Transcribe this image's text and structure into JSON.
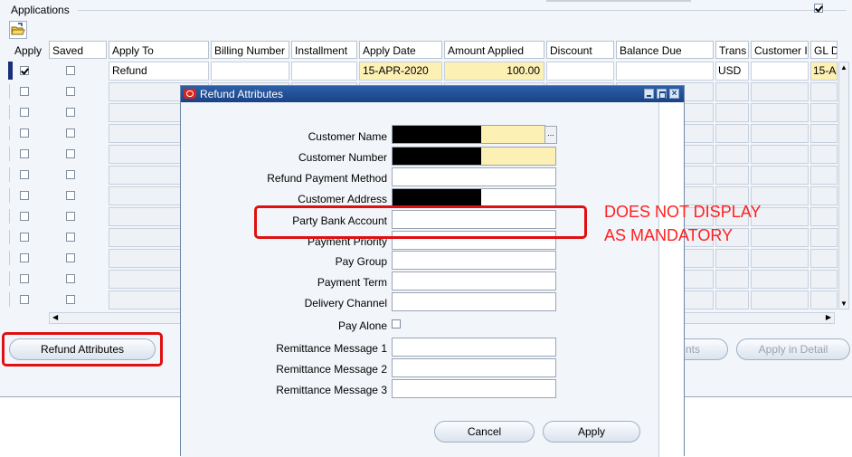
{
  "section": {
    "title": "Applications"
  },
  "columns": [
    "Apply",
    "Saved",
    "Apply To",
    "Billing Number",
    "Installment",
    "Apply Date",
    "Amount Applied",
    "Discount",
    "Balance Due",
    "Trans",
    "Customer I",
    "GL D"
  ],
  "row1": {
    "apply_to": "Refund",
    "apply_date": "15-APR-2020",
    "amount_applied": "100.00",
    "trans": "USD",
    "gl_date": "15-A"
  },
  "buttons": {
    "refund_attributes": "Refund Attributes",
    "adjustments_partial": "nts",
    "apply_in_detail": "Apply in Detail"
  },
  "dialog": {
    "title": "Refund Attributes",
    "labels": {
      "customer_name": "Customer Name",
      "customer_number": "Customer Number",
      "refund_payment_method": "Refund Payment Method",
      "customer_address": "Customer Address",
      "party_bank_account": "Party Bank Account",
      "payment_priority": "Payment Priority",
      "pay_group": "Pay Group",
      "payment_term": "Payment Term",
      "delivery_channel": "Delivery Channel",
      "pay_alone": "Pay Alone",
      "remittance_message_1": "Remittance Message 1",
      "remittance_message_2": "Remittance Message 2",
      "remittance_message_3": "Remittance Message 3"
    },
    "buttons": {
      "cancel": "Cancel",
      "apply": "Apply"
    },
    "lov_glyph": "..."
  },
  "annotation": {
    "line1": "DOES NOT DISPLAY",
    "line2": "AS MANDATORY"
  },
  "colors": {
    "highlight": "#e01010",
    "required_field": "#fdf0b5",
    "title_bar": "#1a4286"
  }
}
